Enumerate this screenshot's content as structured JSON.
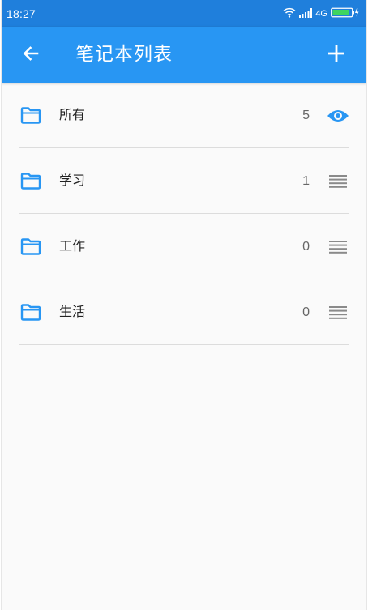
{
  "status_bar": {
    "time": "18:27",
    "network": "4G",
    "icons": [
      "wifi-icon",
      "signal-icon",
      "battery-charging-icon"
    ]
  },
  "app_bar": {
    "title": "笔记本列表",
    "back_icon": "arrow-left-icon",
    "add_icon": "plus-icon"
  },
  "notebooks": [
    {
      "name": "所有",
      "count": "5",
      "icon": "folder-icon",
      "action_icon": "eye-icon"
    },
    {
      "name": "学习",
      "count": "1",
      "icon": "folder-icon",
      "action_icon": "drag-handle-icon"
    },
    {
      "name": "工作",
      "count": "0",
      "icon": "folder-icon",
      "action_icon": "drag-handle-icon"
    },
    {
      "name": "生活",
      "count": "0",
      "icon": "folder-icon",
      "action_icon": "drag-handle-icon"
    }
  ],
  "colors": {
    "status_bar": "#1f7fdc",
    "app_bar": "#2896f3",
    "accent": "#2896f3",
    "background": "#fafafa",
    "divider": "#dcdcdc"
  }
}
